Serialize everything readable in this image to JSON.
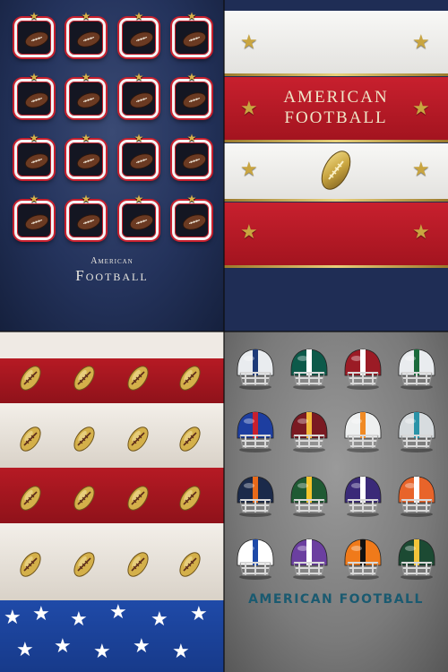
{
  "panels": {
    "p1": {
      "title_small": "American",
      "title_big": "Football",
      "colors": {
        "border_white": "#f4f4f4",
        "border_red": "#c8202e",
        "star": "#d9b24a"
      },
      "icon": "football-icon"
    },
    "p2": {
      "title_line1": "AMERICAN",
      "title_line2": "FOOTBALL",
      "colors": {
        "red": "#c8202e",
        "white": "#f8f8f6",
        "gold": "#c9a540",
        "navy": "#1f2d55"
      },
      "icon": "gold-football-icon"
    },
    "p3": {
      "colors": {
        "red": "#b61a24",
        "white": "#f3efe9",
        "blue": "#1f4aa8",
        "gold": "#d4b04a"
      },
      "icon": "gold-football-icon"
    },
    "p4": {
      "title": "AMERICAN FOOTBALL",
      "helmets": [
        {
          "shell": "#e9ecef",
          "stripe": "#1d3a78",
          "name": "helmet-1"
        },
        {
          "shell": "#0d5a4a",
          "stripe": "#ffffff",
          "name": "helmet-2"
        },
        {
          "shell": "#9b1b25",
          "stripe": "#ffffff",
          "name": "helmet-3"
        },
        {
          "shell": "#e9ecef",
          "stripe": "#1a6b3c",
          "name": "helmet-4"
        },
        {
          "shell": "#1d3ea0",
          "stripe": "#c8202e",
          "name": "helmet-5"
        },
        {
          "shell": "#7a1a22",
          "stripe": "#f2b93b",
          "name": "helmet-6"
        },
        {
          "shell": "#eef0f0",
          "stripe": "#f08a24",
          "name": "helmet-7"
        },
        {
          "shell": "#d7dcdf",
          "stripe": "#2a93a8",
          "name": "helmet-8"
        },
        {
          "shell": "#1b2a4a",
          "stripe": "#e86a1a",
          "name": "helmet-9"
        },
        {
          "shell": "#1f5a33",
          "stripe": "#f5c42c",
          "name": "helmet-10"
        },
        {
          "shell": "#3a2a78",
          "stripe": "#ffffff",
          "name": "helmet-11"
        },
        {
          "shell": "#e8642a",
          "stripe": "#ffffff",
          "name": "helmet-12"
        },
        {
          "shell": "#ffffff",
          "stripe": "#1e4aa8",
          "name": "helmet-13"
        },
        {
          "shell": "#6b3fa0",
          "stripe": "#ffffff",
          "name": "helmet-14"
        },
        {
          "shell": "#f07a1a",
          "stripe": "#111111",
          "name": "helmet-15"
        },
        {
          "shell": "#1c4a33",
          "stripe": "#f3c43a",
          "name": "helmet-16"
        }
      ]
    }
  }
}
